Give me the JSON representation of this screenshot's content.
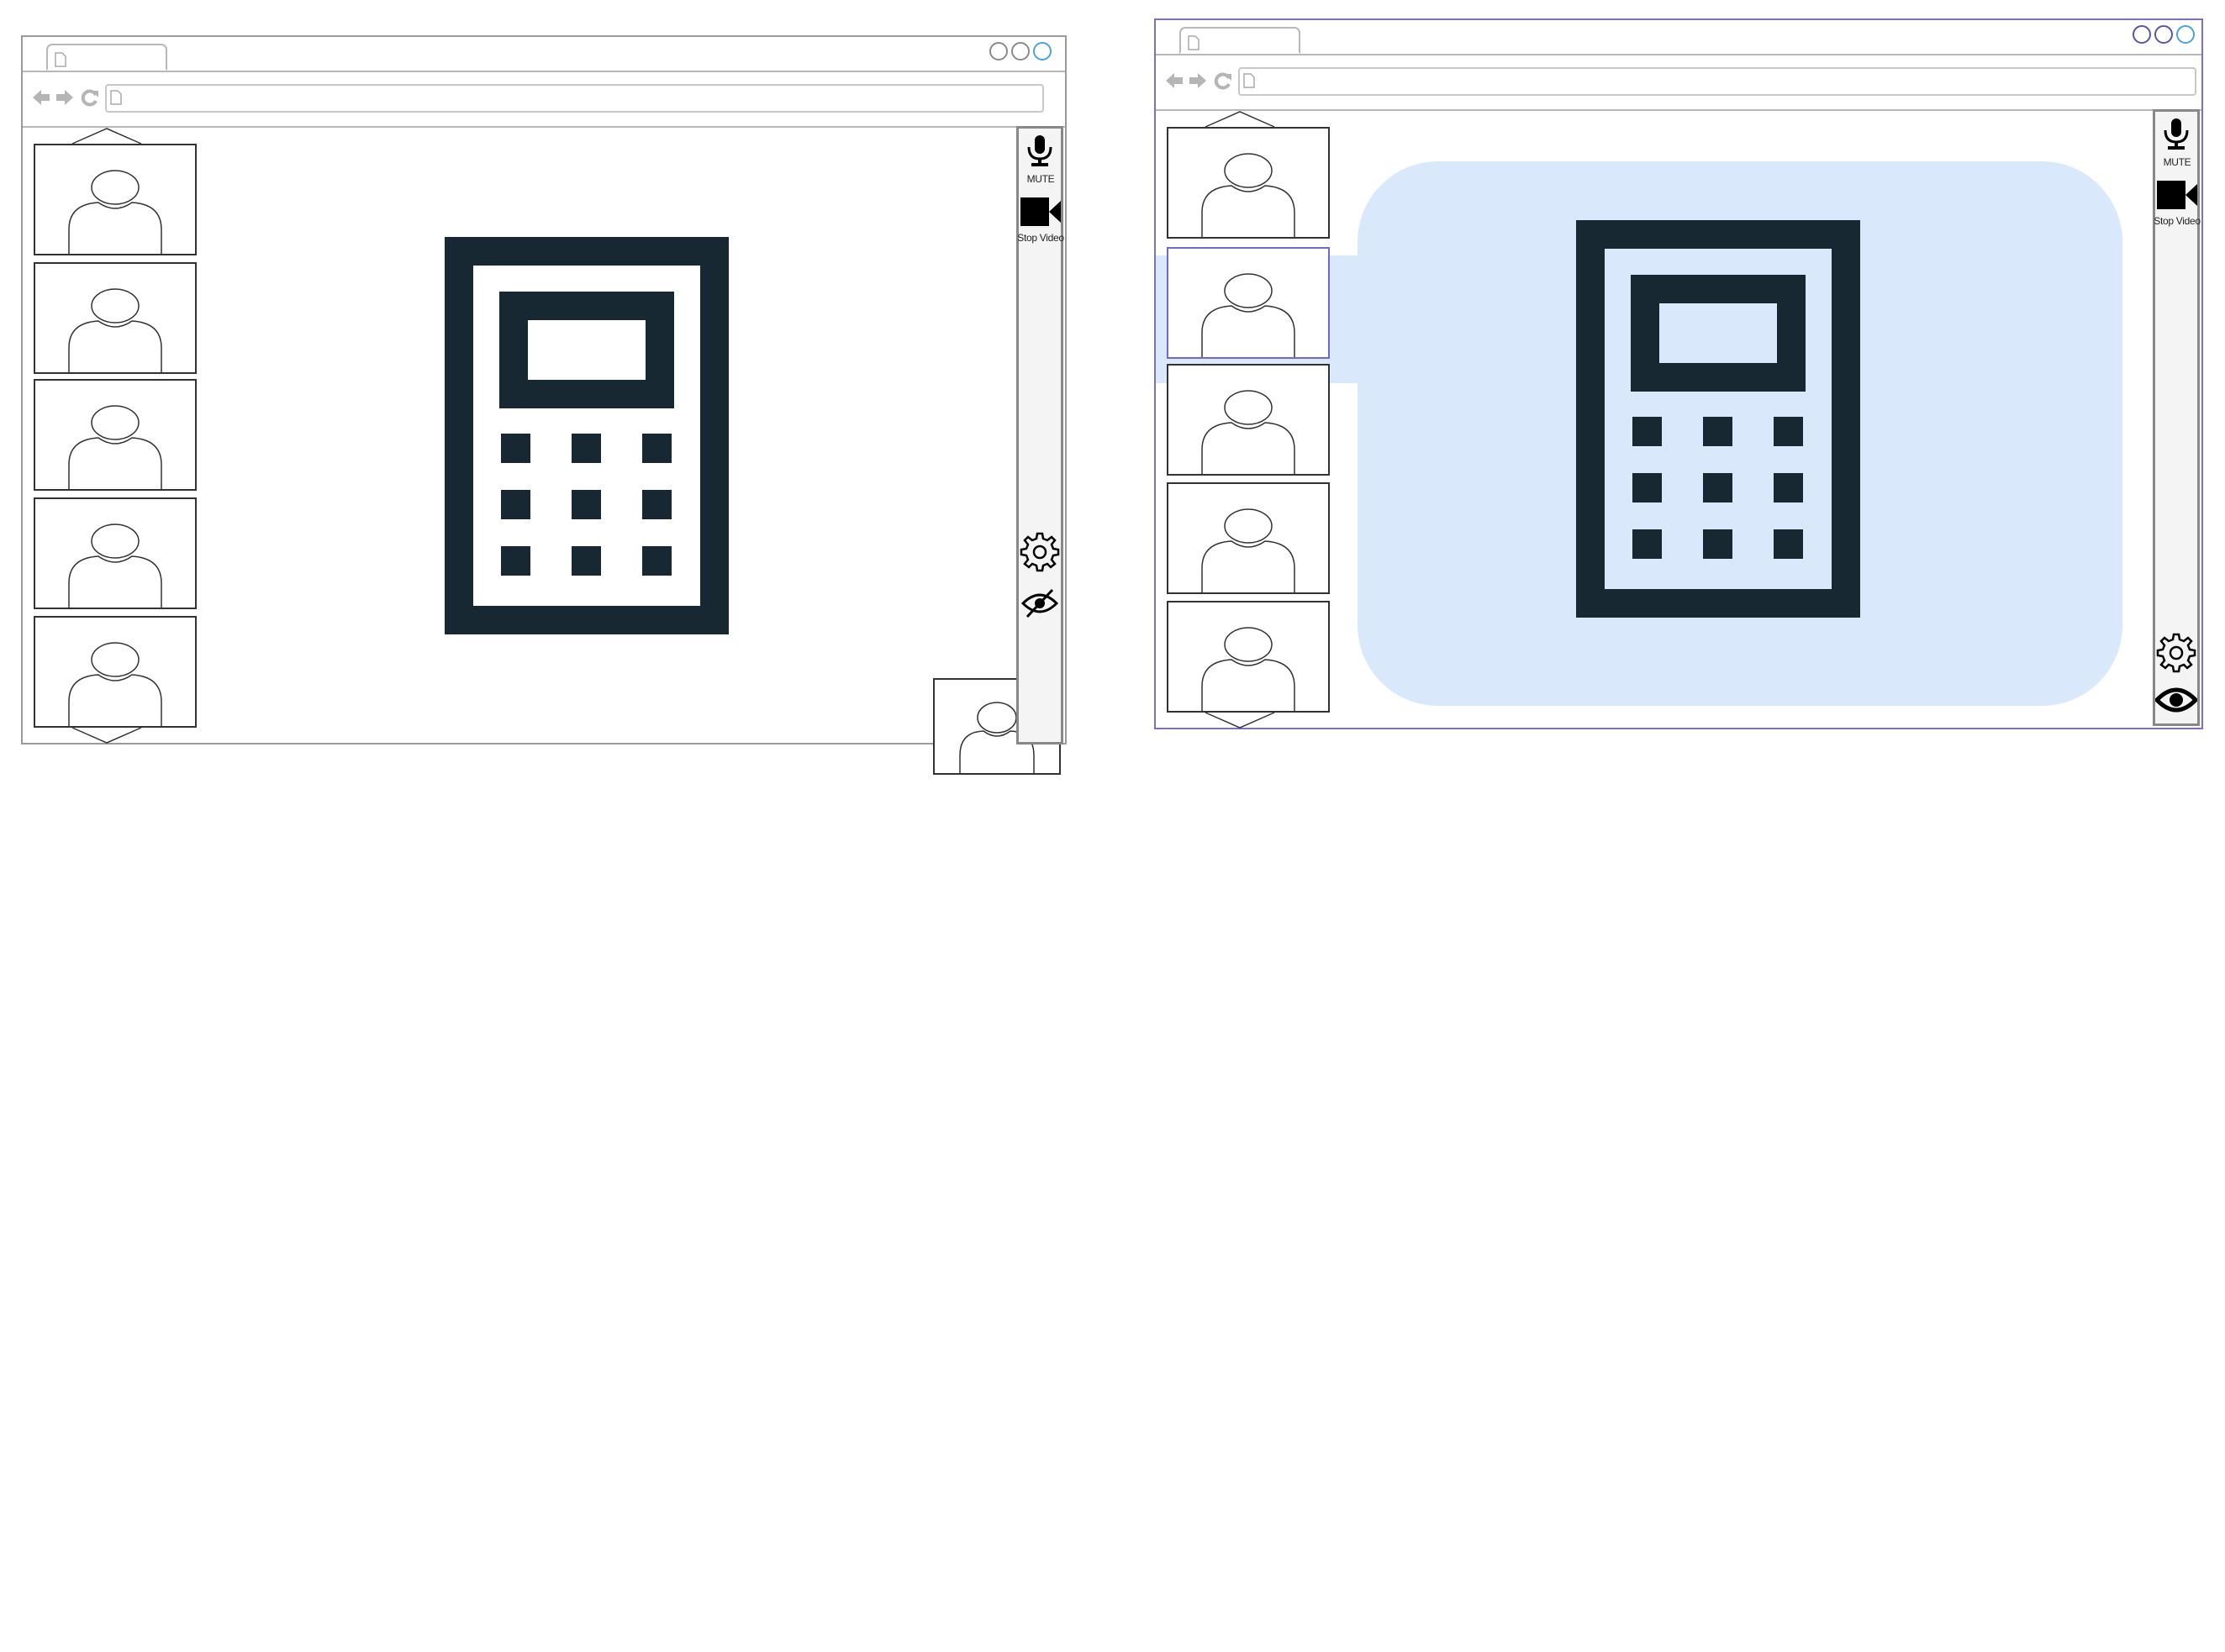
{
  "colors": {
    "frame": "#9a9a9a",
    "selected_frame": "#7a70c8",
    "bubble": "#dae8fc",
    "calculator": "#182833",
    "sidebar_bg": "#f4f4f4"
  },
  "left_mockup": {
    "controls": {
      "mute_label": "MUTE",
      "video_label": "Stop Video",
      "mic_icon": "microphone-icon",
      "camera_icon": "video-camera-icon",
      "settings_icon": "gear-icon",
      "visibility_icon": "eye-slash-icon"
    },
    "participants_visible": 5,
    "self_view": true
  },
  "right_mockup": {
    "controls": {
      "mute_label": "MUTE",
      "video_label": "Stop Video",
      "mic_icon": "microphone-icon",
      "camera_icon": "video-camera-icon",
      "settings_icon": "gear-icon",
      "visibility_icon": "eye-icon"
    },
    "participants_visible": 5,
    "highlighted_participant": 2
  }
}
